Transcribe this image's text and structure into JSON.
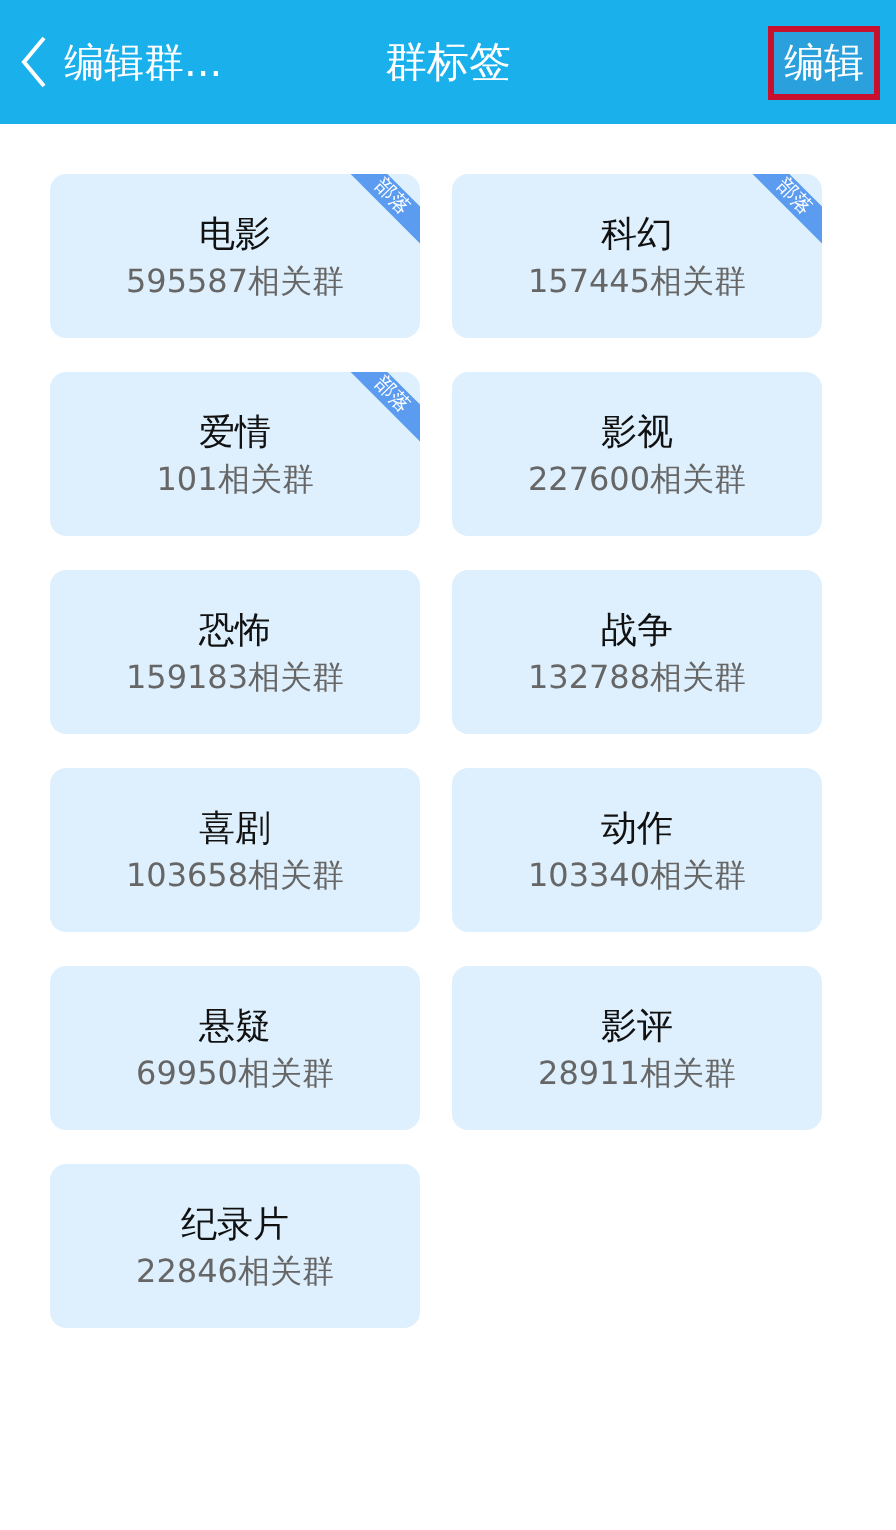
{
  "header": {
    "back_label": "编辑群...",
    "title": "群标签",
    "action": "编辑"
  },
  "tags": [
    {
      "name": "电影",
      "count": "595587相关群",
      "ribbon": "部落"
    },
    {
      "name": "科幻",
      "count": "157445相关群",
      "ribbon": "部落"
    },
    {
      "name": "爱情",
      "count": "101相关群",
      "ribbon": "部落"
    },
    {
      "name": "影视",
      "count": "227600相关群"
    },
    {
      "name": "恐怖",
      "count": "159183相关群"
    },
    {
      "name": "战争",
      "count": "132788相关群"
    },
    {
      "name": "喜剧",
      "count": "103658相关群"
    },
    {
      "name": "动作",
      "count": "103340相关群"
    },
    {
      "name": "悬疑",
      "count": "69950相关群"
    },
    {
      "name": "影评",
      "count": "28911相关群"
    },
    {
      "name": "纪录片",
      "count": "22846相关群"
    }
  ]
}
